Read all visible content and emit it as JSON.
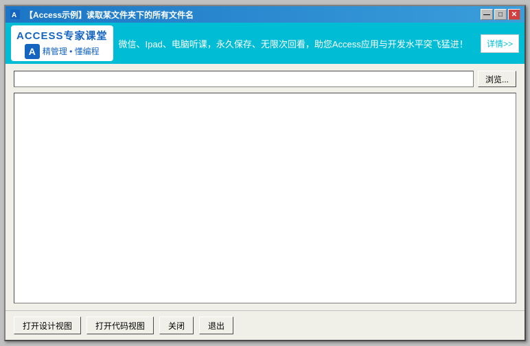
{
  "window": {
    "title": "【Access示例】读取某文件夹下的所有文件名",
    "title_icon": "A"
  },
  "title_controls": {
    "minimize": "—",
    "maximize": "□",
    "close": "✕"
  },
  "ad": {
    "logo_title": "ACCESS专家课堂",
    "logo_sub": "精管理  •  懂编程",
    "text": "微信、Ipad、电脑听课，永久保存、无限次回看，助您Access应用与开发水平突飞猛进！",
    "detail_btn": "详情>>"
  },
  "main": {
    "path_placeholder": "",
    "browse_btn": "浏览...",
    "file_list": []
  },
  "footer": {
    "btn1": "打开设计视图",
    "btn2": "打开代码视图",
    "btn3": "关闭",
    "btn4": "退出"
  }
}
